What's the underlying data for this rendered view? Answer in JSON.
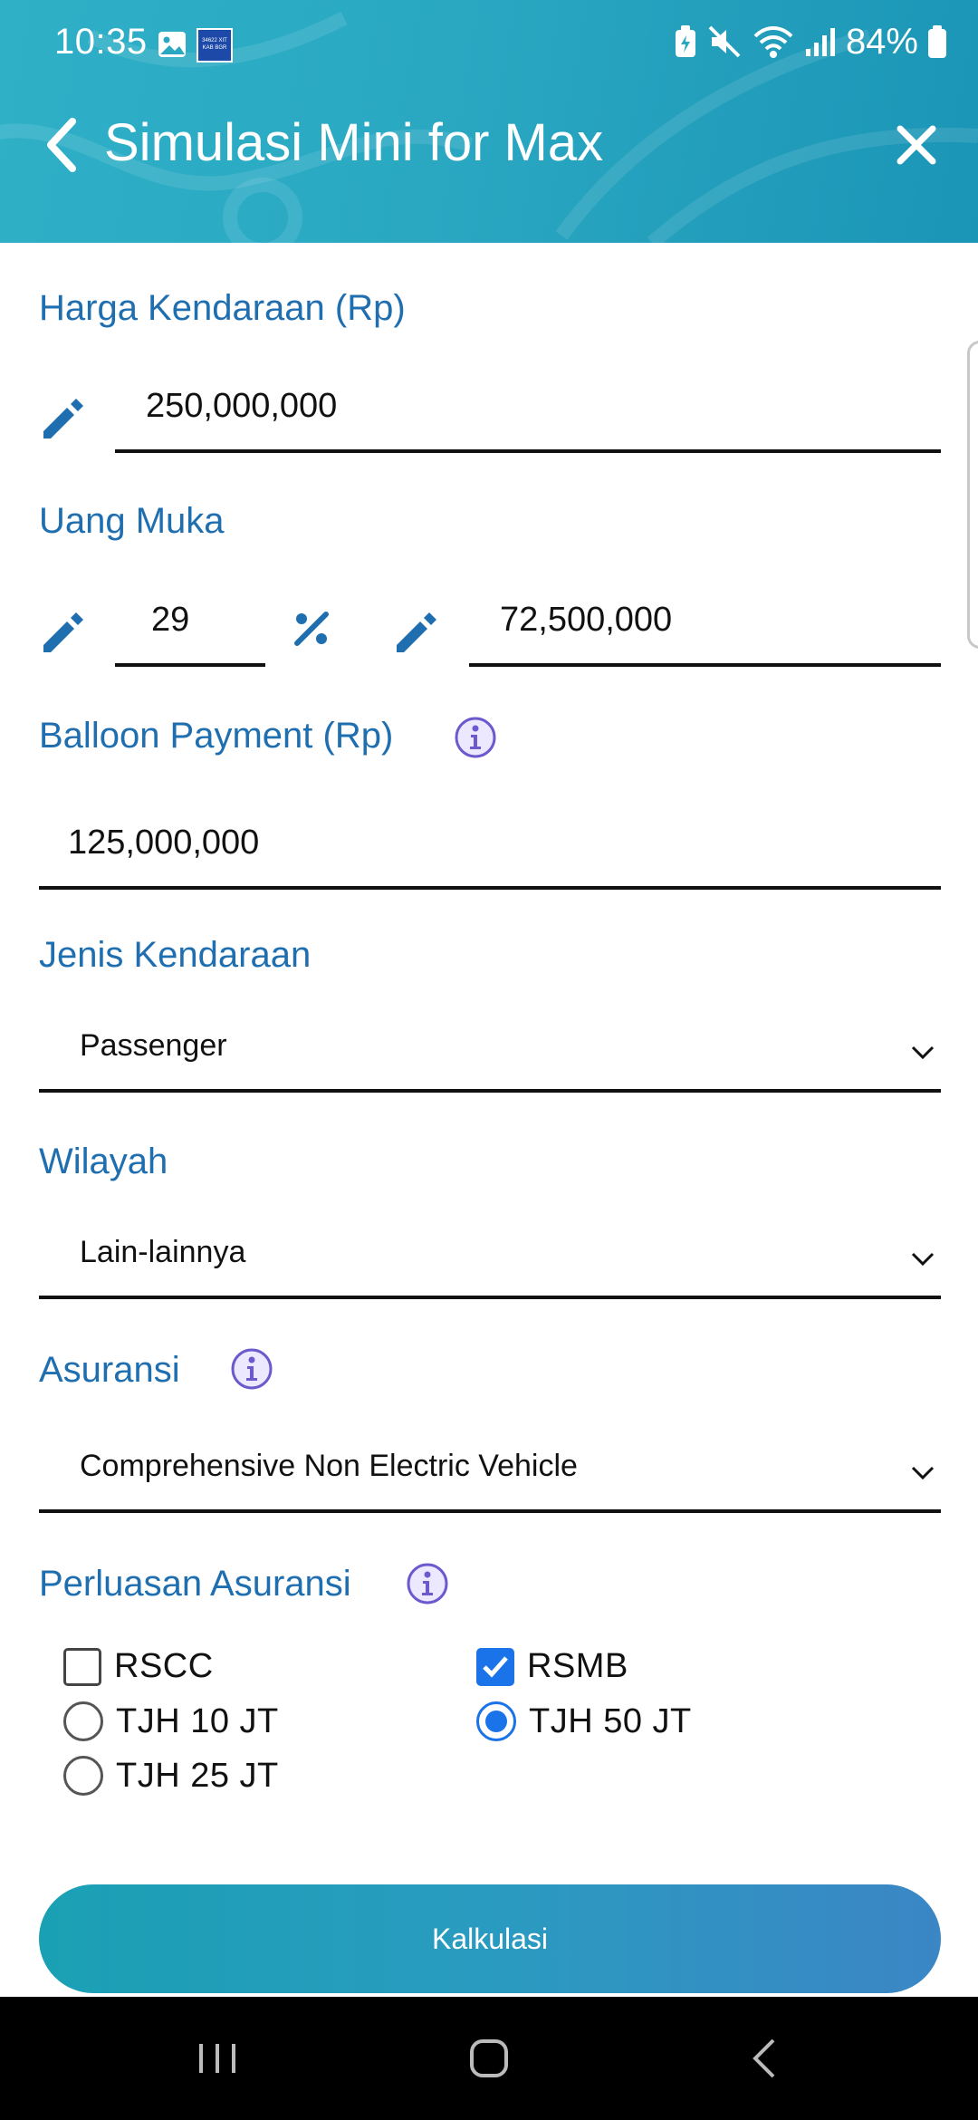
{
  "status_bar": {
    "time": "10:35",
    "battery": "84%",
    "logo_text": "34622 XIT KAB BGR"
  },
  "app_bar": {
    "title": "Simulasi Mini for Max"
  },
  "form": {
    "harga": {
      "label": "Harga Kendaraan (Rp)",
      "value": "250,000,000"
    },
    "uang_muka": {
      "label": "Uang Muka",
      "percent_value": "29",
      "amount_value": "72,500,000"
    },
    "balloon": {
      "label": "Balloon Payment (Rp)",
      "value": "125,000,000"
    },
    "jenis": {
      "label": "Jenis Kendaraan",
      "value": "Passenger"
    },
    "wilayah": {
      "label": "Wilayah",
      "value": "Lain-lainnya"
    },
    "asuransi": {
      "label": "Asuransi",
      "value": "Comprehensive Non Electric Vehicle"
    },
    "perluasan": {
      "label": "Perluasan Asuransi",
      "options": [
        {
          "label": "RSCC",
          "type": "checkbox",
          "checked": false
        },
        {
          "label": "RSMB",
          "type": "checkbox",
          "checked": true
        },
        {
          "label": "TJH 10 JT",
          "type": "radio",
          "checked": false
        },
        {
          "label": "TJH 50 JT",
          "type": "radio",
          "checked": true
        },
        {
          "label": "TJH 25 JT",
          "type": "radio",
          "checked": false
        }
      ]
    }
  },
  "button": {
    "label": "Kalkulasi"
  },
  "colors": {
    "accent_label": "#1f6fb0",
    "header": "#2aa8c2",
    "checked": "#1a73e8",
    "info_icon": "#6a5acd"
  }
}
